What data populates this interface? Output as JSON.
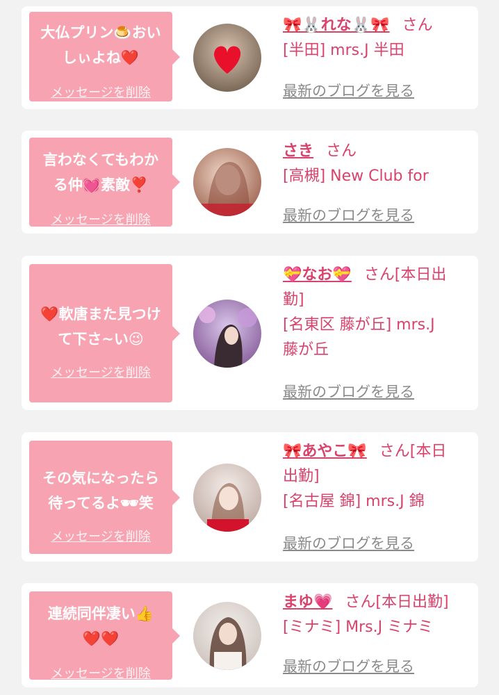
{
  "delete_label": "メッセージを削除",
  "blog_label": "最新のブログを見る",
  "san_suffix": "さん",
  "colors": {
    "page_bg": "#f2f2f2",
    "bubble": "#f7a3b1",
    "accent": "#d9426b",
    "link_gray": "#8a8a8a"
  },
  "cards": [
    {
      "message_line1": "大仏プリン🍮おい",
      "message_line2": "しぃよね❤️",
      "name": "🎀🐰れな🐰🎀",
      "name_suffix": "さん",
      "shop": "[半田] mrs.J 半田"
    },
    {
      "message_line1": "言わなくてもわか",
      "message_line2": "る仲💓素敵❣️",
      "name": "さき",
      "name_suffix": "さん",
      "shop": "[高槻] New Club for"
    },
    {
      "message_line1": "❤️軟唐また見つけ",
      "message_line2": "て下さ~い😉",
      "name": "💝なお💝",
      "name_suffix_line1": "さん[本日出",
      "name_suffix_line2": "勤]",
      "shop_line1": "[名東区 藤が丘] mrs.J",
      "shop_line2": "藤が丘"
    },
    {
      "message_line1": "その気になったら",
      "message_line2": "待ってるよ🕶笑",
      "name": "🎀あやこ🎀",
      "name_suffix_line1": "さん[本日",
      "name_suffix_line2": "出勤]",
      "shop": "[名古屋 錦] mrs.J 錦"
    },
    {
      "message_line1": "連続同伴凄い👍",
      "message_line2": "❤️❤️",
      "name": "まゆ💗",
      "name_suffix": "さん[本日出勤]",
      "shop": "[ミナミ] Mrs.J ミナミ"
    }
  ]
}
